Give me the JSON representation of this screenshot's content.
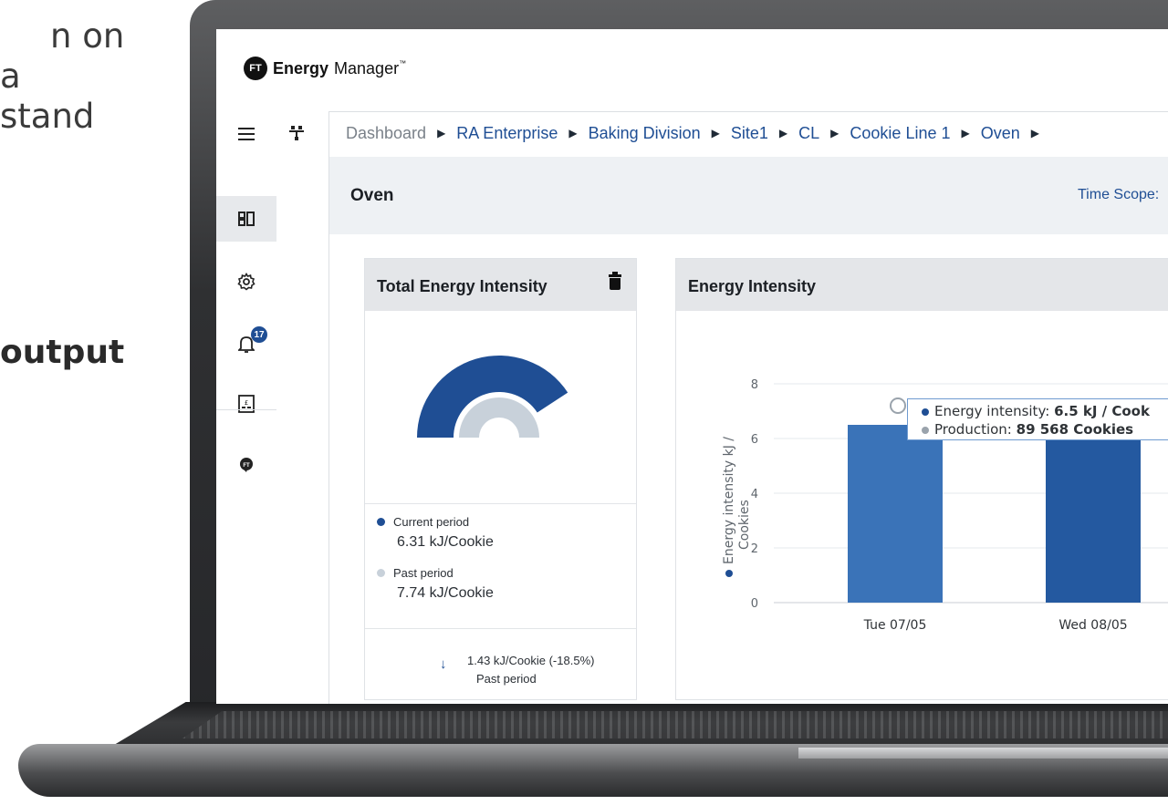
{
  "marketing": {
    "line1": "n on",
    "line2": "a",
    "line3": "stand",
    "bold": "output"
  },
  "app": {
    "brand_bold": "Energy",
    "brand_regular": "Manager",
    "brand_tm": "™",
    "logo_text": "FT"
  },
  "sidebar": {
    "notifications_count": "17",
    "icons": [
      "menu-icon",
      "dashboard-icon",
      "gear-icon",
      "bell-icon",
      "report-icon",
      "ft-logo-icon"
    ]
  },
  "breadcrumb": [
    "Dashboard",
    "RA Enterprise",
    "Baking Division",
    "Site1",
    "CL",
    "Cookie Line 1",
    "Oven"
  ],
  "page": {
    "title": "Oven",
    "time_scope_label": "Time Scope:"
  },
  "total_card": {
    "title": "Total Energy Intensity",
    "current_label": "Current period",
    "current_value": "6.31 kJ/Cookie",
    "past_label": "Past period",
    "past_value": "7.74 kJ/Cookie",
    "delta_value": "1.43 kJ/Cookie (-18.5%)",
    "delta_label": "Past period",
    "gauge_current_fraction": 0.815,
    "gauge_past_fraction": 1.0
  },
  "colors": {
    "primary": "#1f4e94",
    "bar": "#3a73b8",
    "bar_dark": "#2459a0",
    "past": "#c8d1da"
  },
  "intensity_card": {
    "title": "Energy Intensity",
    "tooltip": {
      "energy_label": "Energy intensity:",
      "energy_value": "6.5 kJ / Cook",
      "production_label": "Production:",
      "production_value": "89 568 Cookies"
    }
  },
  "chart_data": {
    "type": "bar",
    "categories": [
      "Tue 07/05",
      "Wed 08/05"
    ],
    "series": [
      {
        "name": "Energy intensity",
        "values": [
          6.5,
          6.4
        ]
      }
    ],
    "ylabel": "Energy intensity kJ / Cookies",
    "ylim": [
      0,
      8
    ],
    "yticks": [
      0,
      2,
      4,
      6,
      8
    ],
    "grid": true
  }
}
